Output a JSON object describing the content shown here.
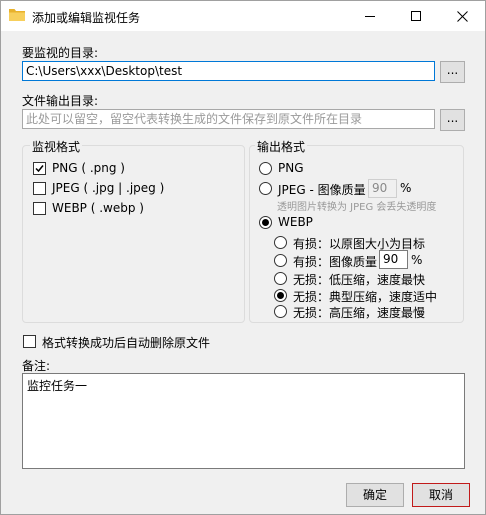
{
  "window": {
    "title": "添加或编辑监视任务",
    "folder_icon_color": "#e8b22c"
  },
  "watch_dir": {
    "label": "要监视的目录:",
    "value": "C:\\Users\\xxx\\Desktop\\test",
    "browse_label": "..."
  },
  "output_dir": {
    "label": "文件输出目录:",
    "placeholder": "此处可以留空，留空代表转换生成的文件保存到原文件所在目录",
    "browse_label": "..."
  },
  "watch_formats": {
    "title": "监视格式",
    "items": [
      {
        "label": "PNG ( .png )",
        "checked": true
      },
      {
        "label": "JPEG ( .jpg | .jpeg )",
        "checked": false
      },
      {
        "label": "WEBP ( .webp )",
        "checked": false
      }
    ]
  },
  "output_formats": {
    "title": "输出格式",
    "png_label": "PNG",
    "jpeg_label": "JPEG - 图像质量",
    "jpeg_quality": "90",
    "jpeg_percent": "%",
    "jpeg_hint": "透明图片转换为 JPEG 会丢失透明度",
    "webp_label": "WEBP",
    "selected": "WEBP",
    "webp_options": {
      "opt1": "有损：以原图大小为目标",
      "opt2": "有损：图像质量",
      "opt2_quality": "90",
      "opt2_percent": "%",
      "opt3": "无损：低压缩，速度最快",
      "opt4": "无损：典型压缩，速度适中",
      "opt5": "无损：高压缩，速度最慢",
      "selected": "opt4"
    }
  },
  "delete_original": {
    "label": "格式转换成功后自动删除原文件",
    "checked": false
  },
  "notes": {
    "label": "备注:",
    "value": "监控任务一"
  },
  "buttons": {
    "ok": "确定",
    "cancel": "取消"
  }
}
